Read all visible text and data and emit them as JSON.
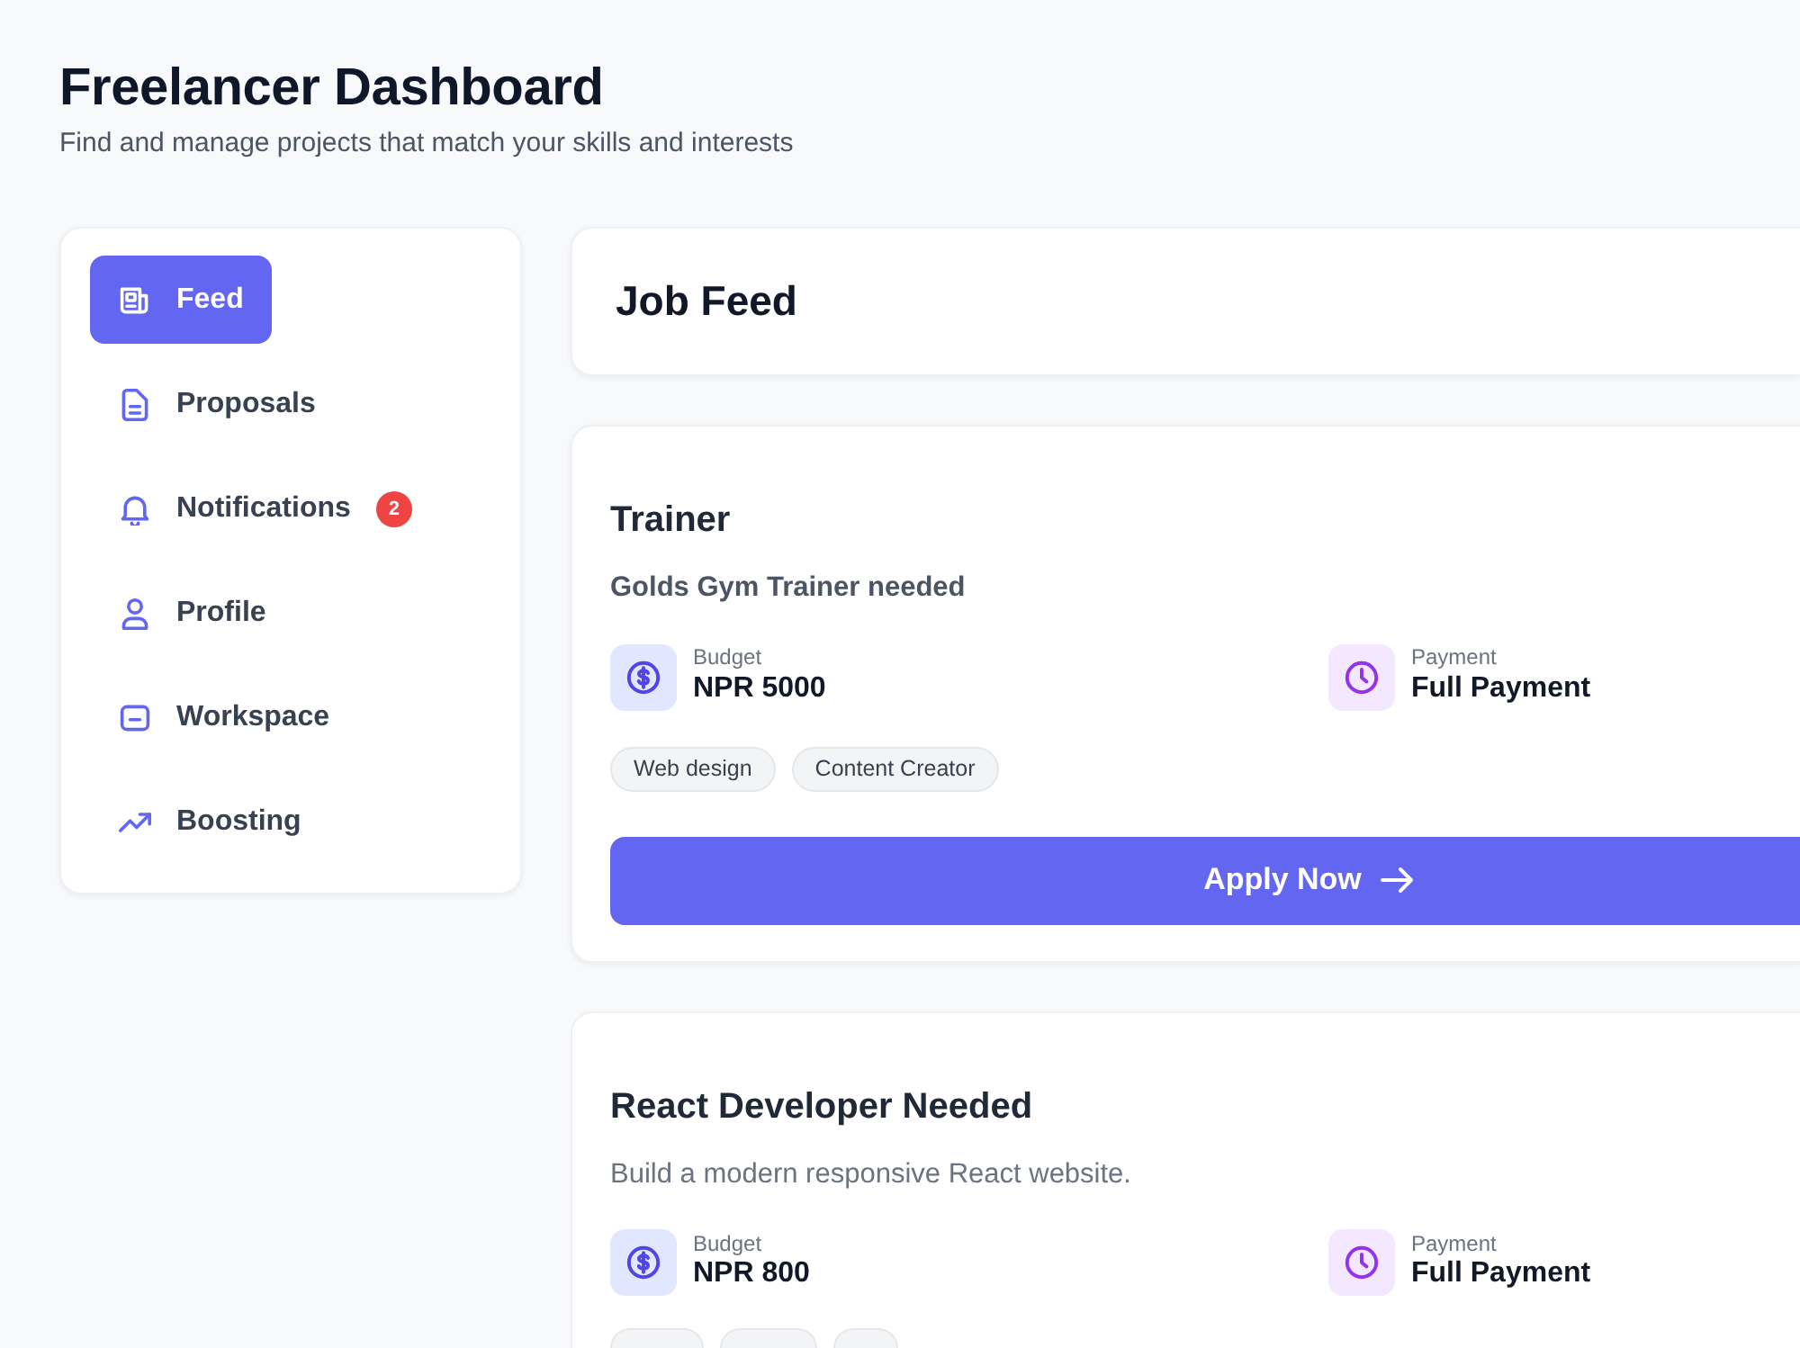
{
  "header": {
    "title": "Freelancer Dashboard",
    "subtitle": "Find and manage projects that match your skills and interests"
  },
  "sidebar": {
    "items": [
      {
        "label": "Feed",
        "selected": true
      },
      {
        "label": "Proposals",
        "selected": false
      },
      {
        "label": "Notifications",
        "selected": false,
        "badge": "2"
      },
      {
        "label": "Profile",
        "selected": false
      },
      {
        "label": "Workspace",
        "selected": false
      },
      {
        "label": "Boosting",
        "selected": false
      }
    ]
  },
  "feed": {
    "title": "Job Feed"
  },
  "jobs": [
    {
      "title": "Trainer",
      "description": "Golds Gym Trainer needed",
      "description_bold": true,
      "details": [
        {
          "label": "Budget",
          "value": "NPR 5000"
        },
        {
          "label": "Payment",
          "value": "Full Payment"
        }
      ],
      "tags": [
        {
          "kind": "full",
          "label": "Web design"
        },
        {
          "kind": "full",
          "label": "Content Creator"
        }
      ],
      "action": "Apply Now"
    },
    {
      "title": "React Developer Needed",
      "description": "Build a modern responsive React website.",
      "description_bold": false,
      "details": [
        {
          "label": "Budget",
          "value": "NPR 800"
        },
        {
          "label": "Payment",
          "value": "Full Payment"
        }
      ],
      "tags": [
        {
          "kind": "clipped"
        },
        {
          "kind": "clipped"
        },
        {
          "kind": "clipped"
        }
      ]
    }
  ]
}
